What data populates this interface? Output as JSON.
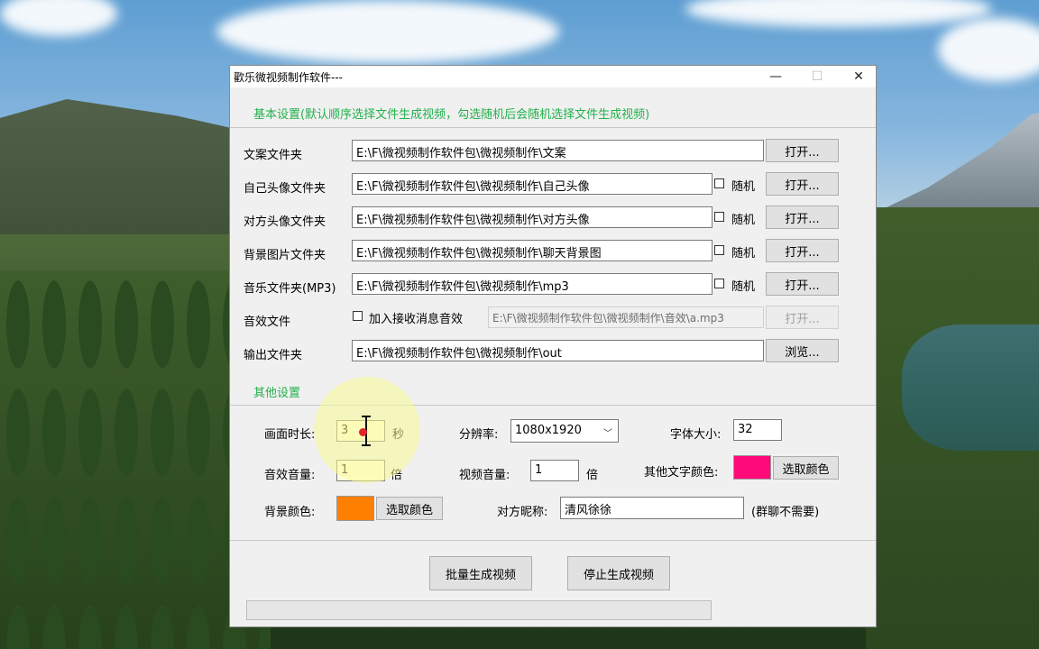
{
  "window": {
    "title": "歡乐微视频制作软件---"
  },
  "sections": {
    "basic": "基本设置(默认顺序选择文件生成视频，勾选随机后会随机选择文件生成视频)",
    "other": "其他设置"
  },
  "rows": {
    "copy": {
      "label": "文案文件夹",
      "path": "E:\\F\\微视频制作软件包\\微视频制作\\文案",
      "button": "打开..."
    },
    "avatar": {
      "label": "自己头像文件夹",
      "path": "E:\\F\\微视频制作软件包\\微视频制作\\自己头像",
      "random": "随机",
      "button": "打开..."
    },
    "peer": {
      "label": "对方头像文件夹",
      "path": "E:\\F\\微视频制作软件包\\微视频制作\\对方头像",
      "random": "随机",
      "button": "打开..."
    },
    "bg": {
      "label": "背景图片文件夹",
      "path": "E:\\F\\微视频制作软件包\\微视频制作\\聊天背景图",
      "random": "随机",
      "button": "打开..."
    },
    "music": {
      "label": "音乐文件夹(MP3)",
      "path": "E:\\F\\微视频制作软件包\\微视频制作\\mp3",
      "random": "随机",
      "button": "打开..."
    },
    "sfx": {
      "label": "音效文件",
      "checkbox": "加入接收消息音效",
      "path": "E:\\F\\微视频制作软件包\\微视频制作\\音效\\a.mp3",
      "button": "打开..."
    },
    "output": {
      "label": "输出文件夹",
      "path": "E:\\F\\微视频制作软件包\\微视频制作\\out",
      "button": "浏览..."
    }
  },
  "other": {
    "duration_label": "画面时长:",
    "duration_value": "3",
    "duration_unit": "秒",
    "resolution_label": "分辨率:",
    "resolution_value": "1080x1920",
    "font_size_label": "字体大小:",
    "font_size_value": "32",
    "sfx_volume_label": "音效音量:",
    "sfx_volume_value": "1",
    "sfx_volume_unit": "倍",
    "video_volume_label": "视频音量:",
    "video_volume_value": "1",
    "video_volume_unit": "倍",
    "text_color_label": "其他文字颜色:",
    "text_color": "#ff0a7a",
    "text_color_button": "选取颜色",
    "bg_color_label": "背景颜色:",
    "bg_color": "#ff8000",
    "bg_color_button": "选取颜色",
    "nickname_label": "对方昵称:",
    "nickname_value": "清风徐徐",
    "nickname_note": "(群聊不需要)"
  },
  "actions": {
    "batch": "批量生成视频",
    "stop": "停止生成视频"
  },
  "progress": 0,
  "colors": {
    "section_green": "#22b14c"
  }
}
